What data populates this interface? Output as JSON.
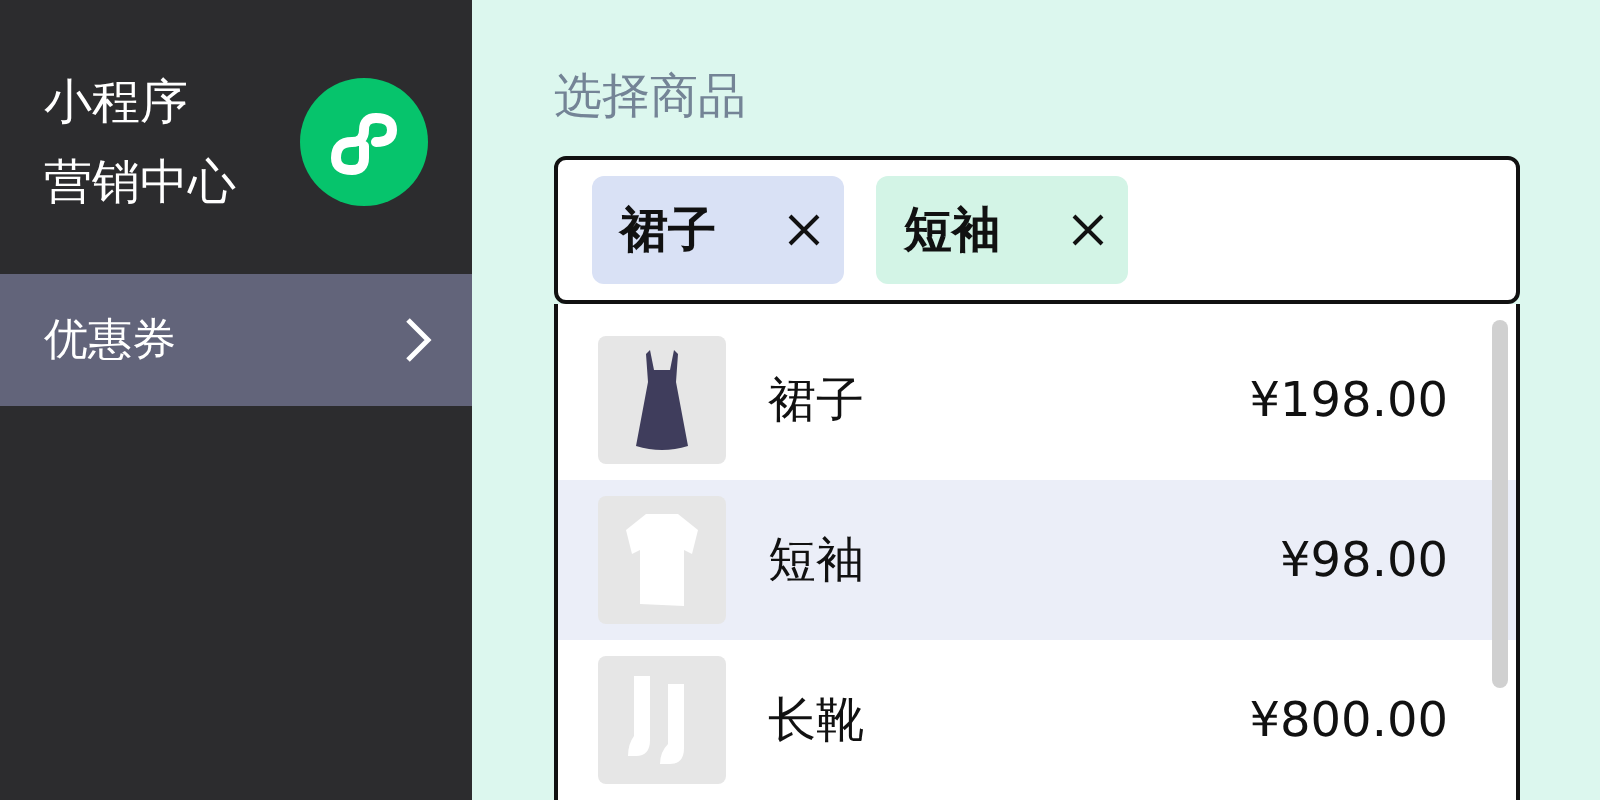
{
  "sidebar": {
    "app_title_lines": [
      "小程序",
      "营销中心"
    ],
    "items": [
      {
        "label": "优惠券",
        "selected": true
      }
    ]
  },
  "main": {
    "label": "选择商品",
    "tags": [
      {
        "label": "裙子",
        "color": "#d9e1f5"
      },
      {
        "label": "短袖",
        "color": "#d3f4e6"
      }
    ],
    "options": [
      {
        "name": "裙子",
        "price": "¥198.00",
        "kind": "dress",
        "highlighted": false
      },
      {
        "name": "短袖",
        "price": "¥98.00",
        "kind": "shirt",
        "highlighted": true
      },
      {
        "name": "长靴",
        "price": "¥800.00",
        "kind": "boots",
        "highlighted": false
      }
    ]
  }
}
